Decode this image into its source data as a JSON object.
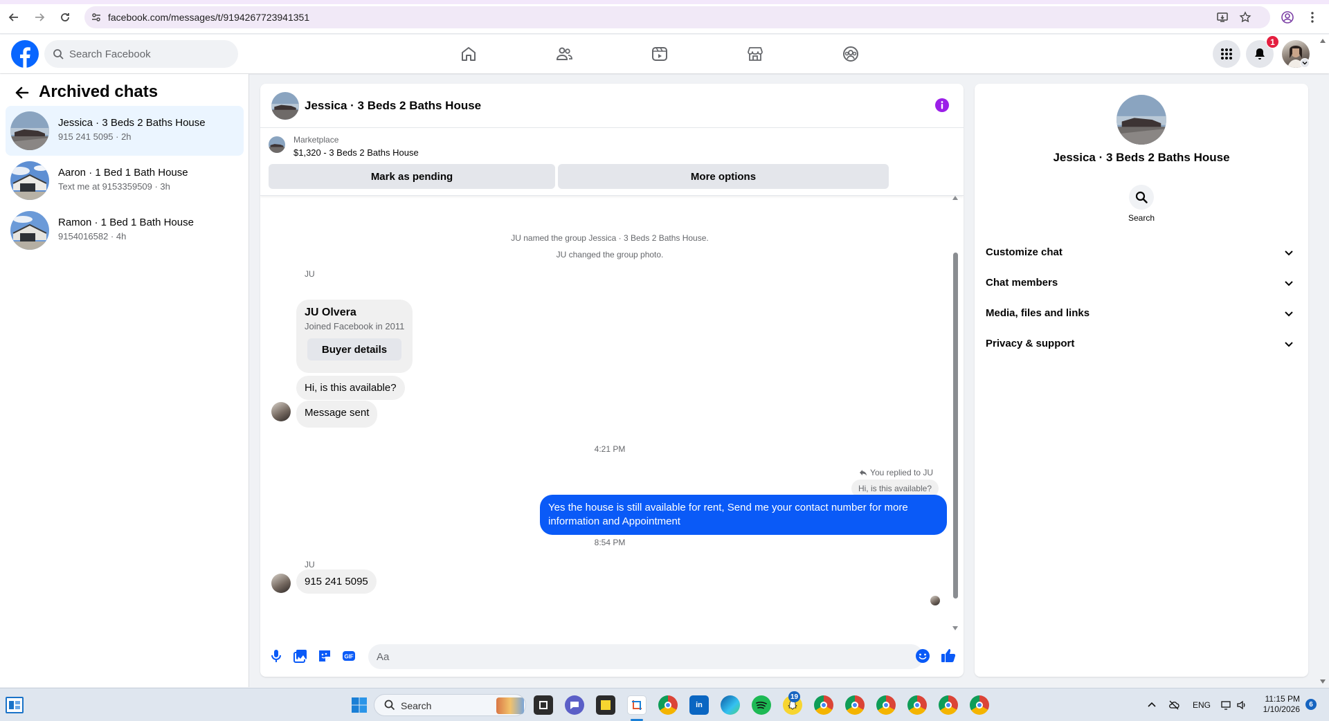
{
  "browser": {
    "url": "facebook.com/messages/t/9194267723941351"
  },
  "fbnav": {
    "search_placeholder": "Search Facebook",
    "notification_count": "1"
  },
  "sidebar": {
    "title": "Archived chats",
    "chats": [
      {
        "name": "Jessica · 3 Beds 2 Baths House",
        "sub": "915 241 5095 · 2h",
        "active": true
      },
      {
        "name": "Aaron · 1 Bed 1 Bath House",
        "sub": "Text me at 9153359509 · 3h",
        "active": false
      },
      {
        "name": "Ramon · 1 Bed 1 Bath House",
        "sub": "9154016582 · 4h",
        "active": false
      }
    ]
  },
  "chat": {
    "title": "Jessica · 3 Beds 2 Baths House",
    "marketplace_label": "Marketplace",
    "listing": "$1,320 - 3 Beds 2 Baths House",
    "mark_pending_label": "Mark as pending",
    "more_options_label": "More options",
    "system_messages": [
      "JU named the group Jessica · 3 Beds 2 Baths House.",
      "JU changed the group photo."
    ],
    "sender_initials": "JU",
    "buyer_card": {
      "name": "JU Olvera",
      "joined": "Joined Facebook in 2011",
      "button": "Buyer details"
    },
    "msg_available": "Hi, is this available?",
    "msg_sent": "Message sent",
    "time_1": "4:21 PM",
    "reply_note": "You replied to JU",
    "quoted": "Hi, is this available?",
    "outgoing": "Yes the house is still available for rent, Send me your contact number for more information and Appointment",
    "time_2": "8:54 PM",
    "msg_phone": "915 241 5095",
    "composer_placeholder": "Aa"
  },
  "right_panel": {
    "title": "Jessica · 3 Beds 2 Baths House",
    "search_label": "Search",
    "sections": [
      "Customize chat",
      "Chat members",
      "Media, files and links",
      "Privacy & support"
    ]
  },
  "taskbar": {
    "search_label": "Search",
    "badge_chat": "19",
    "language": "ENG",
    "time": "11:15 PM",
    "date": "1/10/2026",
    "notif_count": "6"
  },
  "colors": {
    "accent": "#0a5af7",
    "info_purple": "#9b1fe8",
    "active_chat_bg": "#ebf5ff",
    "badge_red": "#e41e3f"
  }
}
